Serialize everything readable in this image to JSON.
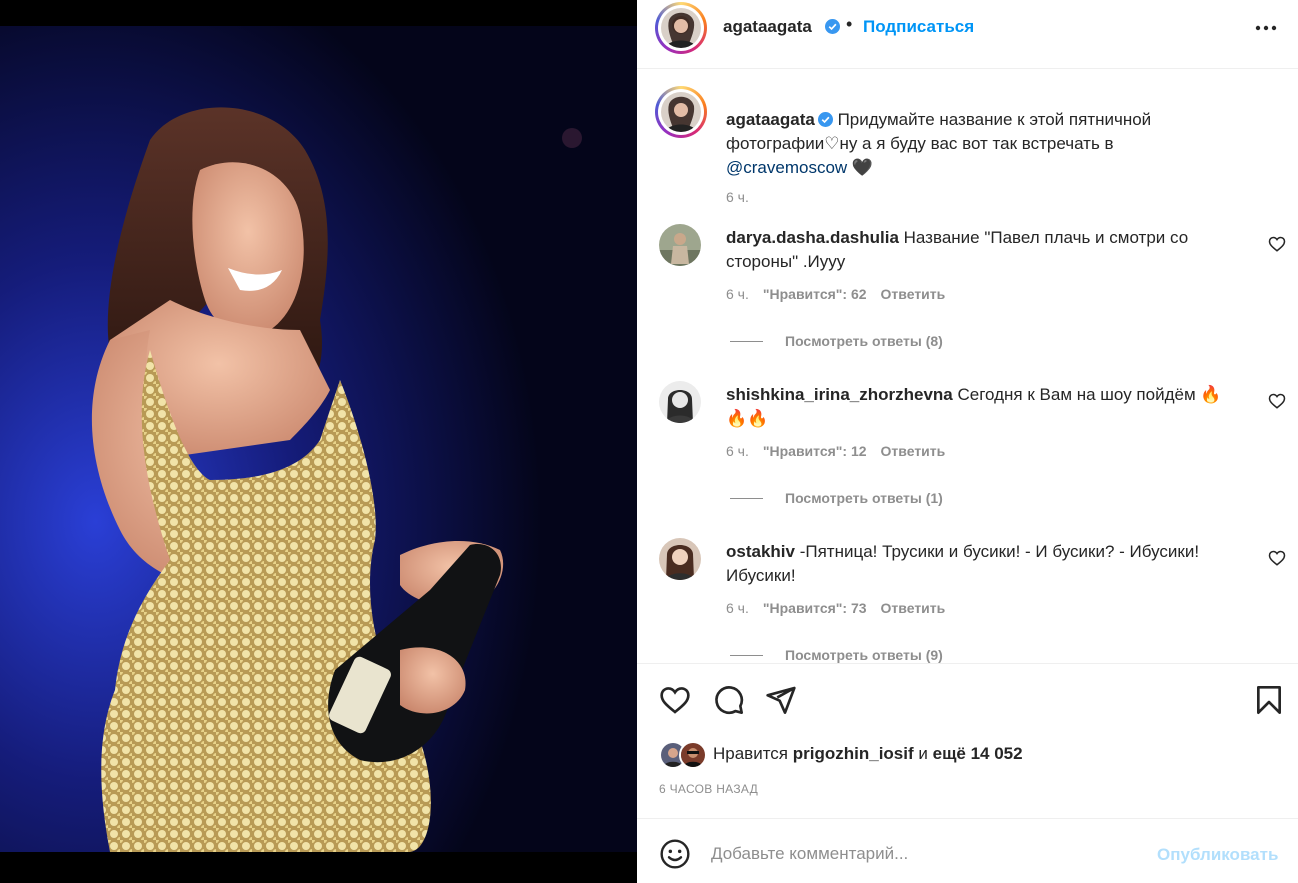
{
  "post": {
    "author": "agataagata",
    "follow_label": "Подписаться",
    "dot": "•",
    "caption": {
      "text": "Придумайте название к этой пятничной фотографии♡ну а я буду вас вот так встречать в",
      "mention": "@cravemoscow",
      "emoji": "🖤",
      "time": "6 ч."
    }
  },
  "comments": [
    {
      "user": "darya.dasha.dashulia",
      "text": "Название \"Павел плачь и смотри со стороны\" .Иууу",
      "time": "6 ч.",
      "likes": "\"Нравится\": 62",
      "reply": "Ответить",
      "view_replies": "Посмотреть ответы (8)"
    },
    {
      "user": "shishkina_irina_zhorzhevna",
      "text": "Сегодня к Вам на шоу пойдём 🔥🔥🔥",
      "time": "6 ч.",
      "likes": "\"Нравится\": 12",
      "reply": "Ответить",
      "view_replies": "Посмотреть ответы (1)"
    },
    {
      "user": "ostakhiv",
      "text": "-Пятница! Трусики и бусики! - И бусики? - Ибусики! Ибусики!",
      "time": "6 ч.",
      "likes": "\"Нравится\": 73",
      "reply": "Ответить",
      "view_replies": "Посмотреть ответы (9)"
    }
  ],
  "likes_bar": {
    "prefix": "Нравится",
    "user": "prigozhin_iosif",
    "and": "и",
    "rest": "ещё 14 052"
  },
  "posted": "6 ЧАСОВ НАЗАД",
  "composer": {
    "placeholder": "Добавьте комментарий...",
    "publish": "Опубликовать"
  },
  "icons": {
    "more": "more-icon",
    "like": "heart-icon",
    "comment": "comment-icon",
    "share": "share-icon",
    "save": "bookmark-icon",
    "emoji": "emoji-icon",
    "verified": "verified-badge-icon"
  },
  "colors": {
    "link": "#0095f6",
    "mention": "#00376b",
    "muted": "#8e8e8e",
    "publish_disabled": "#b2dffc",
    "verified": "#3897f0"
  }
}
